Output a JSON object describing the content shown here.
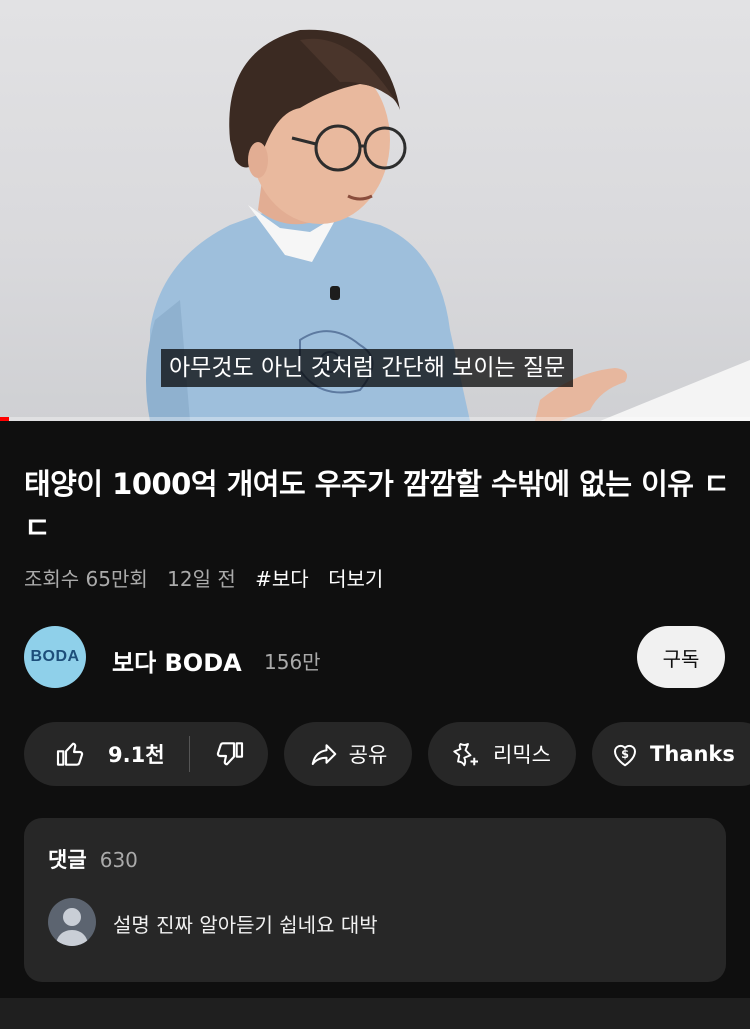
{
  "video": {
    "subtitle": "아무것도 아닌 것처럼 간단해 보이는 질문",
    "progress": 0.012
  },
  "title": "태양이 1000억 개여도 우주가 깜깜할 수밖에 없는 이유 ㄷㄷ",
  "meta": {
    "views": "조회수 65만회",
    "age": "12일 전",
    "hashtag": "#보다",
    "more": "더보기"
  },
  "channel": {
    "avatar_text": "BODA",
    "name": "보다 BODA",
    "subscribers": "156만",
    "subscribe_label": "구독",
    "avatar_color": "#8fd0ea"
  },
  "actions": {
    "like_count": "9.1천",
    "share": "공유",
    "remix": "리믹스",
    "thanks": "Thanks",
    "icons": [
      "thumb-up-icon",
      "thumb-down-icon",
      "share-icon",
      "remix-icon",
      "thanks-icon"
    ]
  },
  "comments": {
    "label": "댓글",
    "count": "630",
    "top_comment": "설명 진짜 알아듣기 쉽네요 대박"
  },
  "colors": {
    "background": "#0f0f0f",
    "pill": "#272727",
    "progress": "#ff0000",
    "secondary_text": "#aaaaaa"
  }
}
